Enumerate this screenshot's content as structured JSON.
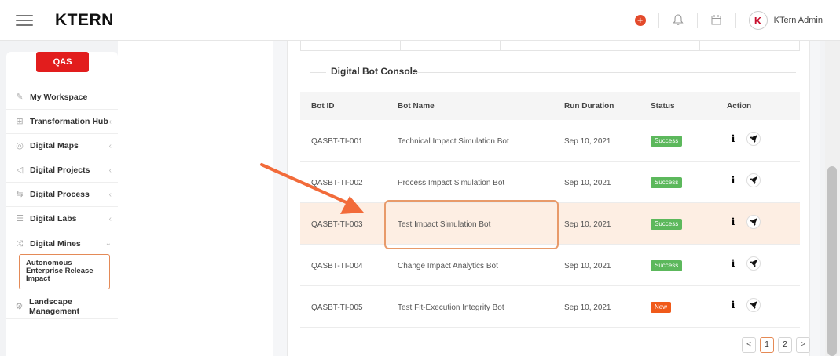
{
  "app": {
    "logo_text": "KTERN",
    "user_name": "KTern Admin",
    "avatar_letter": "K"
  },
  "sidebar": {
    "environment_badge": "QAS",
    "items": [
      {
        "label": "My Workspace",
        "icon": "edit-icon"
      },
      {
        "label": "Transformation Hub",
        "icon": "grid-icon"
      },
      {
        "label": "Digital Maps",
        "icon": "map-icon"
      },
      {
        "label": "Digital Projects",
        "icon": "send-icon"
      },
      {
        "label": "Digital Process",
        "icon": "process-icon"
      },
      {
        "label": "Digital Labs",
        "icon": "list-icon"
      },
      {
        "label": "Digital Mines",
        "icon": "shuffle-icon"
      }
    ],
    "sub_item": "Autonomous Enterprise Release Impact",
    "landscape": "Landscape Management"
  },
  "console": {
    "title": "Digital Bot Console",
    "columns": [
      "Bot ID",
      "Bot Name",
      "Run Duration",
      "Status",
      "Action"
    ],
    "rows": [
      {
        "id": "QASBT-TI-001",
        "name": "Technical Impact Simulation Bot",
        "run": "Sep 10, 2021",
        "status": "Success"
      },
      {
        "id": "QASBT-TI-002",
        "name": "Process Impact Simulation Bot",
        "run": "Sep 10, 2021",
        "status": "Success"
      },
      {
        "id": "QASBT-TI-003",
        "name": "Test Impact Simulation Bot",
        "run": "Sep 10, 2021",
        "status": "Success"
      },
      {
        "id": "QASBT-TI-004",
        "name": "Change Impact Analytics Bot",
        "run": "Sep 10, 2021",
        "status": "Success"
      },
      {
        "id": "QASBT-TI-005",
        "name": "Test Fit-Execution Integrity Bot",
        "run": "Sep 10, 2021",
        "status": "New"
      }
    ],
    "highlighted_row_index": 2
  },
  "pagination": {
    "prev": "<",
    "pages": [
      "1",
      "2"
    ],
    "next": ">",
    "current": "1"
  },
  "colors": {
    "accent": "#e21d1d",
    "success": "#5cb85c",
    "new": "#f05a1a",
    "highlight": "#fdeee3",
    "annotation": "#f26b3a"
  }
}
